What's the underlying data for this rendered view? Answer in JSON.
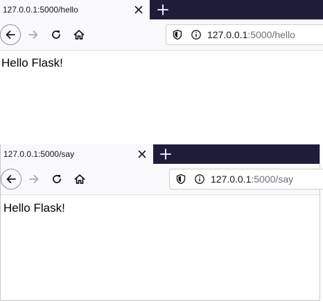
{
  "colors": {
    "tabstrip_bg": "#1f1c3a",
    "toolbar_bg": "#f9f9fb",
    "url_path": "#6e6e78"
  },
  "windows": [
    {
      "tab": {
        "title": "127.0.0.1:5000/hello",
        "close_icon": "close-icon"
      },
      "new_tab_icon": "plus-icon",
      "nav": {
        "back_icon": "arrow-left-icon",
        "forward_icon": "arrow-right-icon",
        "reload_icon": "reload-icon",
        "home_icon": "home-icon"
      },
      "urlbar": {
        "host": "127.0.0.1",
        "path": ":5000/hello",
        "shield_icon": "shield-icon",
        "info_icon": "info-icon"
      },
      "content": {
        "text": "Hello Flask!"
      }
    },
    {
      "tab": {
        "title": "127.0.0.1:5000/say",
        "close_icon": "close-icon"
      },
      "new_tab_icon": "plus-icon",
      "nav": {
        "back_icon": "arrow-left-icon",
        "forward_icon": "arrow-right-icon",
        "reload_icon": "reload-icon",
        "home_icon": "home-icon"
      },
      "urlbar": {
        "host": "127.0.0.1",
        "path": ":5000/say",
        "shield_icon": "shield-icon",
        "info_icon": "info-icon"
      },
      "content": {
        "text": "Hello Flask!"
      }
    }
  ]
}
